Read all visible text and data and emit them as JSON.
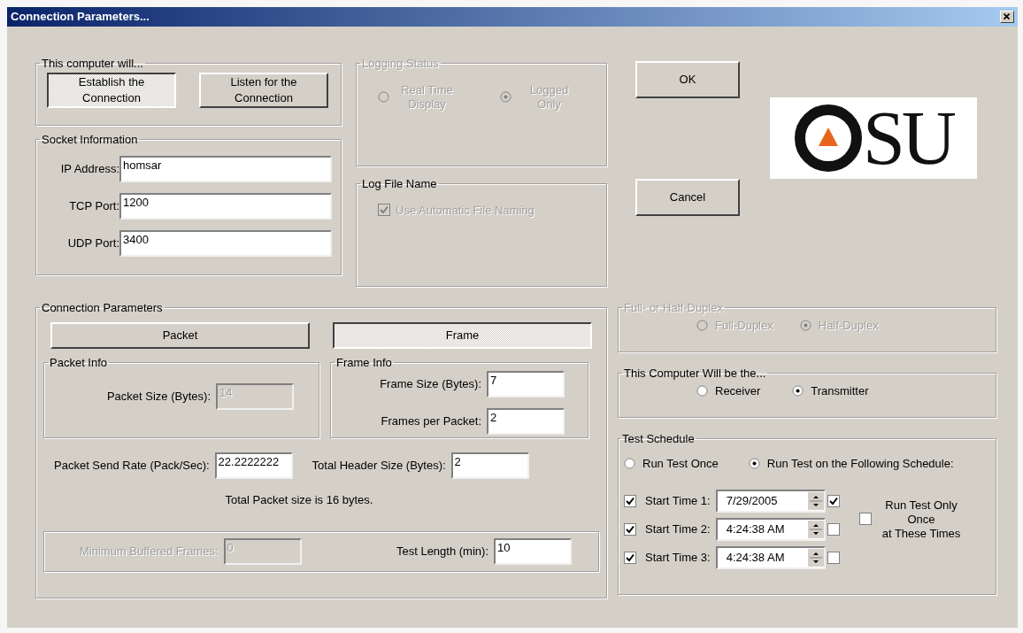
{
  "window": {
    "title": "Connection Parameters..."
  },
  "computer_will": {
    "title": "This computer will...",
    "buttons": [
      {
        "label": "Establish the Connection",
        "selected": true
      },
      {
        "label": "Listen for the Connection",
        "selected": false
      }
    ]
  },
  "socket_information": {
    "title": "Socket Information",
    "fields": [
      {
        "label": "IP Address:",
        "value": "homsar"
      },
      {
        "label": "TCP Port:",
        "value": "1200"
      },
      {
        "label": "UDP Port:",
        "value": "3400"
      }
    ]
  },
  "logging_status": {
    "title": "Logging Status",
    "disabled": true,
    "options": [
      {
        "label": "Real Time Display",
        "selected": false
      },
      {
        "label": "Logged Only",
        "selected": true
      }
    ]
  },
  "log_file_name": {
    "title": "Log File Name",
    "checkbox": {
      "label": "Use Automatic File Naming",
      "checked": true,
      "disabled": true
    }
  },
  "dialog_buttons": [
    {
      "label": "OK"
    },
    {
      "label": "Cancel"
    }
  ],
  "logo": {
    "text": "SU"
  },
  "connection_parameters": {
    "title": "Connection Parameters",
    "modes": [
      {
        "label": "Packet",
        "selected": false
      },
      {
        "label": "Frame",
        "selected": true
      }
    ],
    "packet_info": {
      "title": "Packet Info",
      "field": {
        "label": "Packet Size (Bytes):",
        "value": "14",
        "disabled": true
      }
    },
    "frame_info": {
      "title": "Frame Info",
      "fields": [
        {
          "label": "Frame Size (Bytes):",
          "value": "7"
        },
        {
          "label": "Frames per Packet:",
          "value": "2"
        }
      ]
    },
    "send_rate": {
      "label": "Packet Send Rate (Pack/Sec):",
      "value": "22.2222222"
    },
    "header_size": {
      "label": "Total Header Size (Bytes):",
      "value": "2"
    },
    "summary": "Total Packet size is 16 bytes.",
    "min_buffered": {
      "label": "Minimum Buffered Frames:",
      "value": "0",
      "disabled": true
    },
    "test_length": {
      "label": "Test Length (min):",
      "value": "10"
    }
  },
  "duplex": {
    "title": "Full- or Half-Duplex",
    "disabled": true,
    "options": [
      {
        "label": "Full-Duplex",
        "selected": false
      },
      {
        "label": "Half-Duplex",
        "selected": true
      }
    ]
  },
  "role": {
    "title": "This Computer Will be the...",
    "options": [
      {
        "label": "Receiver",
        "selected": false
      },
      {
        "label": "Transmitter",
        "selected": true
      }
    ]
  },
  "test_schedule": {
    "title": "Test Schedule",
    "modes": [
      {
        "label": "Run Test Once",
        "selected": false
      },
      {
        "label": "Run Test on the Following Schedule:",
        "selected": true
      }
    ],
    "rows": [
      {
        "enabled": true,
        "label": "Start Time 1:",
        "value": "7/29/2005",
        "checked": true
      },
      {
        "enabled": true,
        "label": "Start Time 2:",
        "value": "4:24:38 AM",
        "checked": false
      },
      {
        "enabled": true,
        "label": "Start Time 3:",
        "value": "4:24:38 AM",
        "checked": false
      }
    ],
    "once": {
      "checked": false,
      "lines": [
        "Run Test Only",
        "Once",
        "at These Times"
      ]
    }
  }
}
